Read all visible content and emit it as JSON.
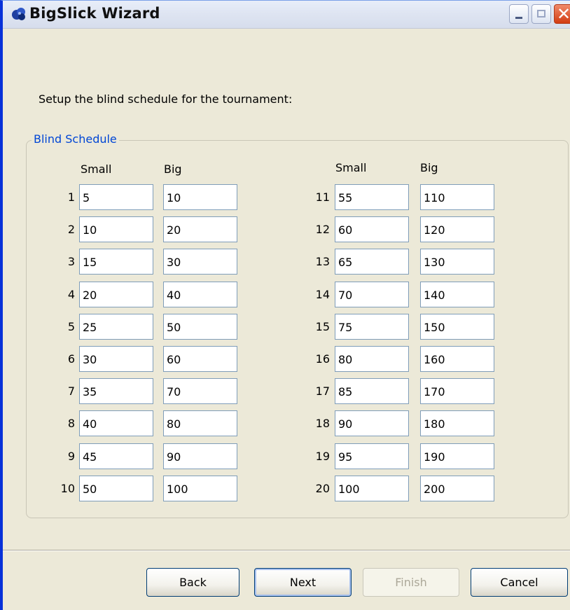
{
  "window": {
    "title": "BigSlick Wizard",
    "icons": [
      "app-icon",
      "minimize-icon",
      "maximize-icon",
      "close-icon"
    ]
  },
  "intro_text": "Setup the blind schedule for the tournament:",
  "group": {
    "label": "Blind Schedule",
    "left_headers": {
      "small": "Small",
      "big": "Big"
    },
    "right_headers": {
      "small": "Small",
      "big": "Big"
    }
  },
  "levels": [
    {
      "num": "1",
      "small": "5",
      "big": "10"
    },
    {
      "num": "2",
      "small": "10",
      "big": "20"
    },
    {
      "num": "3",
      "small": "15",
      "big": "30"
    },
    {
      "num": "4",
      "small": "20",
      "big": "40"
    },
    {
      "num": "5",
      "small": "25",
      "big": "50"
    },
    {
      "num": "6",
      "small": "30",
      "big": "60"
    },
    {
      "num": "7",
      "small": "35",
      "big": "70"
    },
    {
      "num": "8",
      "small": "40",
      "big": "80"
    },
    {
      "num": "9",
      "small": "45",
      "big": "90"
    },
    {
      "num": "10",
      "small": "50",
      "big": "100"
    },
    {
      "num": "11",
      "small": "55",
      "big": "110"
    },
    {
      "num": "12",
      "small": "60",
      "big": "120"
    },
    {
      "num": "13",
      "small": "65",
      "big": "130"
    },
    {
      "num": "14",
      "small": "70",
      "big": "140"
    },
    {
      "num": "15",
      "small": "75",
      "big": "150"
    },
    {
      "num": "16",
      "small": "80",
      "big": "160"
    },
    {
      "num": "17",
      "small": "85",
      "big": "170"
    },
    {
      "num": "18",
      "small": "90",
      "big": "180"
    },
    {
      "num": "19",
      "small": "95",
      "big": "190"
    },
    {
      "num": "20",
      "small": "100",
      "big": "200"
    }
  ],
  "buttons": {
    "back": "Back",
    "next": "Next",
    "finish": "Finish",
    "cancel": "Cancel"
  },
  "colors": {
    "group_label": "#0046d5",
    "window_bg": "#ece9d8",
    "disabled_text": "#aca899"
  }
}
